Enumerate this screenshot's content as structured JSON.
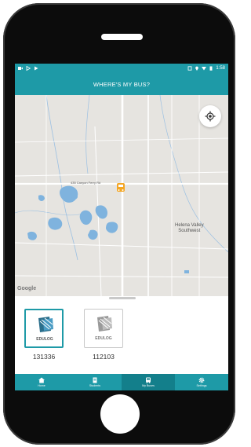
{
  "status_bar": {
    "time": "1:58"
  },
  "app_bar": {
    "title": "WHERE'S MY BUS?"
  },
  "map": {
    "road_label": "435 Canyon Ferry Rd",
    "place_label_line1": "Helena Valley",
    "place_label_line2": "Southwest",
    "attribution": "Google"
  },
  "buses": [
    {
      "logo_text": "EDULOG",
      "number": "131336",
      "selected": true
    },
    {
      "logo_text": "EDULOG",
      "number": "112103",
      "selected": false
    }
  ],
  "nav": [
    {
      "label": "Home",
      "icon": "home-icon"
    },
    {
      "label": "Students",
      "icon": "students-icon"
    },
    {
      "label": "My Buses",
      "icon": "bus-icon",
      "active": true
    },
    {
      "label": "Settings",
      "icon": "gear-icon"
    }
  ],
  "colors": {
    "primary": "#1e9aa7",
    "active_tab": "#137f8b",
    "water": "#7fb3de",
    "bus_marker": "#f4a623"
  }
}
